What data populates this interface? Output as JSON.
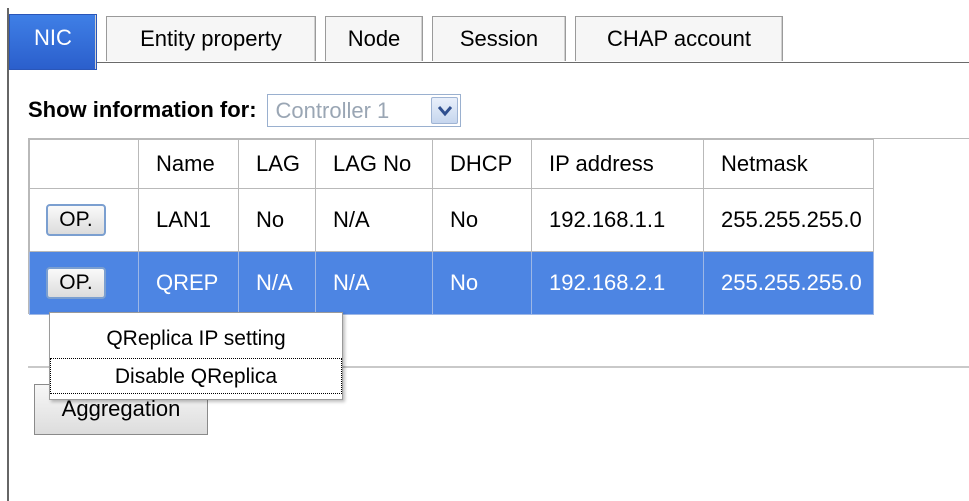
{
  "tabs": [
    {
      "label": "NIC",
      "active": true
    },
    {
      "label": "Entity property",
      "active": false
    },
    {
      "label": "Node",
      "active": false
    },
    {
      "label": "Session",
      "active": false
    },
    {
      "label": "CHAP account",
      "active": false
    }
  ],
  "filter": {
    "label": "Show information for:",
    "selected": "Controller 1",
    "icon": "chevron-down-icon"
  },
  "table": {
    "columns": [
      "",
      "Name",
      "LAG",
      "LAG No",
      "DHCP",
      "IP address",
      "Netmask"
    ],
    "rows": [
      {
        "op": "OP.",
        "name": "LAN1",
        "lag": "No",
        "lag_no": "N/A",
        "dhcp": "No",
        "ip": "192.168.1.1",
        "netmask": "255.255.255.0",
        "selected": false
      },
      {
        "op": "OP.",
        "name": "QREP",
        "lag": "N/A",
        "lag_no": "N/A",
        "dhcp": "No",
        "ip": "192.168.2.1",
        "netmask": "255.255.255.0",
        "selected": true
      }
    ]
  },
  "context_menu": {
    "items": [
      "QReplica IP setting",
      "Disable QReplica"
    ],
    "focused_index": 1
  },
  "aggregation_button": "Aggregation",
  "colors": {
    "active_tab": "#3f7fe6",
    "selected_row": "#4d85e3",
    "op_button_border": "#7b9fd0"
  }
}
